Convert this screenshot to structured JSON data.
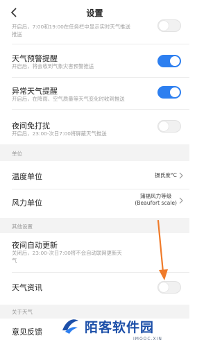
{
  "header": {
    "title": "设置"
  },
  "items": {
    "truncated_desc": "开启后，7:00和19:00在任务栏中显示实时天气推送",
    "warning_title": "天气预警提醒",
    "warning_desc": "开启后，将会收到气象灾害预警推送",
    "abnormal_title": "异常天气提醒",
    "abnormal_desc": "开启后，在降雨、空气质量等天气变化时收到推送",
    "dnd_title": "夜间免打扰",
    "dnd_desc": "开启后，23:00-次日7:00将屏蔽天气推送",
    "temp_title": "温度单位",
    "temp_value": "摄氏度°C",
    "wind_title": "风力单位",
    "wind_value_1": "蒲福风力等级",
    "wind_value_2": "(Beaufort scale)",
    "night_update_title": "夜间自动更新",
    "night_update_desc_1": "关闭后，23:00-次日7:00将不会自动联网更新天",
    "night_update_desc_2": "气",
    "news_title": "天气资讯",
    "feedback_title": "意见反馈"
  },
  "sections": {
    "units": "单位",
    "other": "其他设置",
    "about": "关于天气"
  },
  "toggles": {
    "truncated": false,
    "warning": true,
    "abnormal": true,
    "dnd": false,
    "night_update": false,
    "news": false
  },
  "watermark": {
    "text": "陌客软件园",
    "sub": "IMOOC.XIN"
  },
  "colors": {
    "toggle_on": "#2d7ff0",
    "arrow": "#f07b2a",
    "section_bg": "#f3f3f3"
  }
}
